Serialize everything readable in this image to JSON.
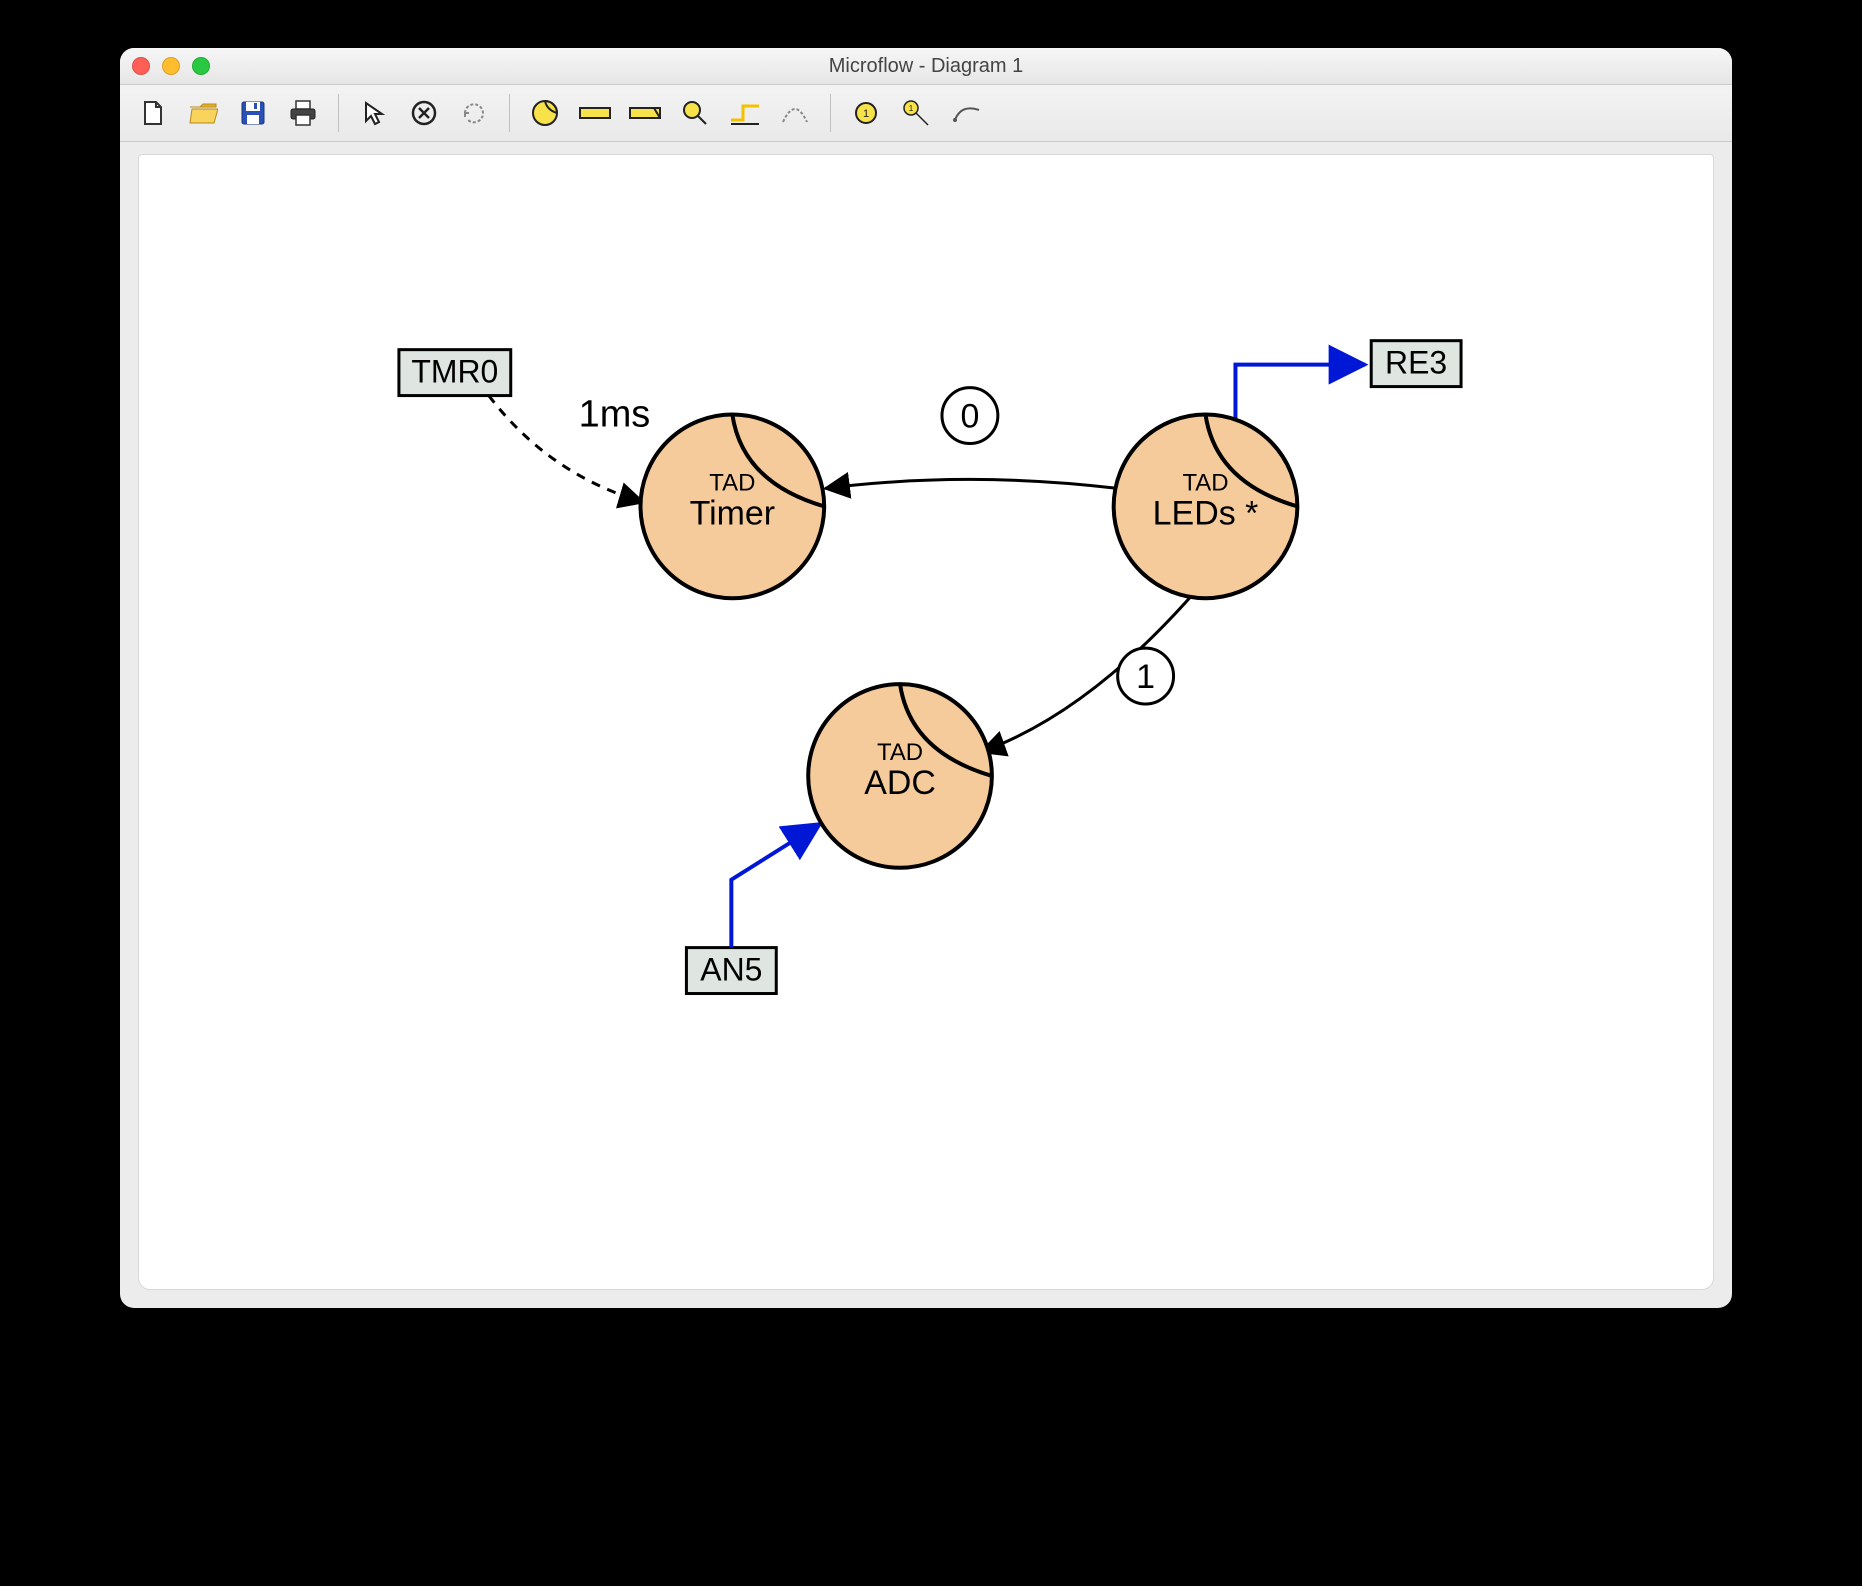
{
  "window": {
    "title": "Microflow - Diagram 1"
  },
  "toolbar": {
    "new": "New",
    "open": "Open",
    "save": "Save",
    "print": "Print",
    "select": "Select",
    "delete": "Delete",
    "rotate": "Rotate",
    "tad_node": "TAD Node",
    "process_bar": "Process",
    "process_bar_alt": "Process Alt",
    "magnify": "Magnify",
    "angle_line": "Angle Connector",
    "arc": "Arc Connector",
    "numbered_dot": "Numbered Marker",
    "numbered_point": "Numbered Pointer",
    "curve": "Curve"
  },
  "diagram": {
    "tag_label": "TAD",
    "nodes": {
      "timer": {
        "name": "Timer"
      },
      "leds": {
        "name": "LEDs *"
      },
      "adc": {
        "name": "ADC"
      }
    },
    "ports": {
      "tmr0": "TMR0",
      "re3": "RE3",
      "an5": "AN5"
    },
    "edge_labels": {
      "tmr0_timer": "1ms",
      "leds_timer": "0",
      "leds_adc": "1"
    }
  }
}
